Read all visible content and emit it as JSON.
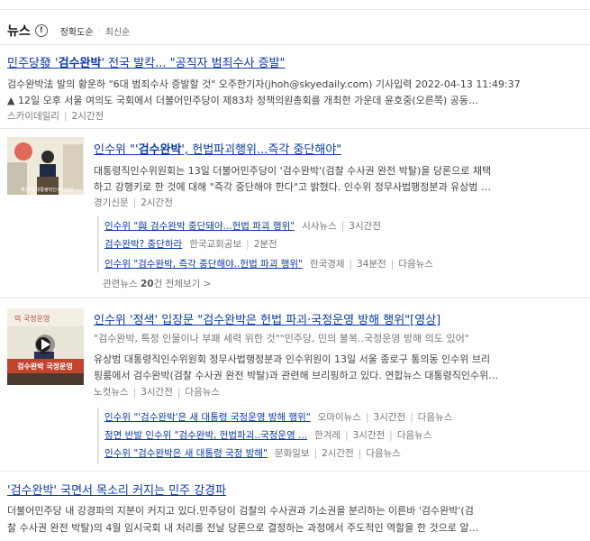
{
  "header": {
    "title": "뉴스",
    "info": "!",
    "sort_accuracy": "정확도순",
    "sort_dot": "·",
    "sort_latest": "최신순"
  },
  "article1": {
    "title_pre": "민주당發 '",
    "title_bold": "검수완박",
    "title_post": "' 전국 발칵... \"공직자 범죄수사 증발\"",
    "line1": "검수완박法 발의 황운하 \"6대 범죄수사 증발할 것\" 오주한기자(jhoh@skyedaily.com) 기사입력 2022-04-13 11:49:37",
    "line2": "▲ 12일 오후 서울 여의도 국회에서 더불어민주당이 제83차 정책의원총회를 개최한 가운데 윤호중(오른쪽) 공동…",
    "source": "스카이데일리",
    "time": "2시간전"
  },
  "article2": {
    "title_pre": "인수위 \"'",
    "title_bold": "검수완박",
    "title_post": "', 헌법파괴행위...즉각 중단해야\"",
    "line1": "대통령직인수위원회는 13일 더불어민주당이 '검수완박'(검찰 수사권 완전 박탈)을 당론으로 채택",
    "line2": "하고 강행키로 한 것에 대해 \"즉각 중단해야 한다\"고 밝혔다. 인수위 정무사법행정분과 유상범 …",
    "source": "경기신문",
    "time": "2시간전",
    "related": [
      {
        "title": "인수위 \"與 검수완박 중단돼야...헌법 파괴 행위\"",
        "source": "시사뉴스",
        "time": "3시간전",
        "extra": ""
      },
      {
        "title": "검수완박? 중단하라",
        "source": "한국교회공보",
        "time": "2분전",
        "extra": ""
      },
      {
        "title": "인수위 \"검수완박, 즉각 중단해야..헌법 파괴 행위\"",
        "source": "한국경제",
        "time": "34분전",
        "extra": "다음뉴스"
      }
    ],
    "related_more_pre": "관련뉴스 ",
    "related_more_count": "20",
    "related_more_post": "건 전체보기 >"
  },
  "article3": {
    "title": "인수위 '정색' 입장문 \"검수완박은 헌법 파괴·국정운영 방해 행위\"[영상]",
    "quote": "\"검수완박, 특정 인물이나 부패 세력 위한 것\"\"민주당, 민의 불복..국정운영 방해 의도 있어\"",
    "line1": "유상범 대통령직인수위원회 정무사법행정분과 인수위원이 13일 서울 종로구 통의동 인수위 브리",
    "line2": "핑룸에서 검수완박(검찰 수사권 완전 박탈)과 관련해 브리핑하고 있다. 연합뉴스 대통령직인수위…",
    "source": "노컷뉴스",
    "time": "3시간전",
    "extra": "다음뉴스",
    "related": [
      {
        "title": "인수위 \"'검수완박'은 새 대통령 국정운영 방해 행위\"",
        "source": "오마이뉴스",
        "time": "3시간전",
        "extra": "다음뉴스"
      },
      {
        "title": "정면 반발 인수위 \"검수완박, 헌법파괴..국정운영 ...",
        "source": "한겨레",
        "time": "3시간전",
        "extra": "다음뉴스"
      },
      {
        "title": "인수위 \"검수완박은 새 대통령 국정 방해\"",
        "source": "문화일보",
        "time": "2시간전",
        "extra": "다음뉴스"
      }
    ]
  },
  "article4": {
    "title": "'검수완박' 국면서 목소리 커지는 민주 강경파",
    "line1": "더불어민주당 내 강경파의 지분이 커지고 있다.민주당이 검찰의 수사권과 기소권을 분리하는 이른바 '검수완박'(검",
    "line2": "찰 수사권 완전 박탈)의 4월 임시국회 내 처리를 전날 당론으로 결정하는 과정에서 주도적인 역할을 한 것으로 알…"
  },
  "thumb1_caption": "제20대 대통령직인수위원회",
  "thumb2_caption": "검수완박 국정운영",
  "thumb2_banner": "의 국정운영"
}
